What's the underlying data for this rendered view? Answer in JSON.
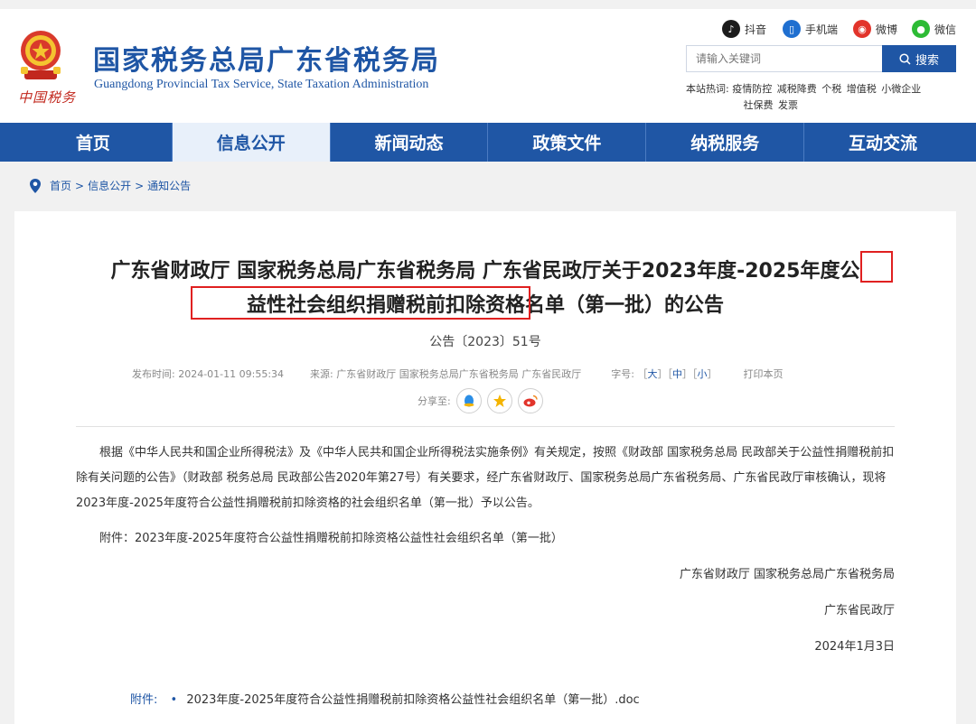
{
  "header": {
    "emblem_script": "中国税务",
    "site_title": "国家税务总局广东省税务局",
    "site_subtitle": "Guangdong Provincial Tax Service, State Taxation Administration",
    "social": {
      "douyin": "抖音",
      "mobile": "手机端",
      "weibo": "微博",
      "wechat": "微信"
    },
    "search": {
      "placeholder": "请输入关键词",
      "button": "搜索"
    },
    "hot": {
      "label": "本站热词:",
      "words": [
        "疫情防控",
        "减税降费",
        "个税",
        "增值税",
        "小微企业",
        "社保费",
        "发票"
      ]
    }
  },
  "nav": {
    "items": [
      "首页",
      "信息公开",
      "新闻动态",
      "政策文件",
      "纳税服务",
      "互动交流"
    ],
    "active_index": 1
  },
  "breadcrumb": [
    "首页",
    "信息公开",
    "通知公告"
  ],
  "article": {
    "title_line1": "广东省财政厅 国家税务总局广东省税务局 广东省民政厅关于2023年度-2025年度公",
    "title_line2": "益性社会组织捐赠税前扣除资格名单（第一批）的公告",
    "doc_no": "公告〔2023〕51号",
    "meta": {
      "published_label": "发布时间:",
      "published": "2024-01-11 09:55:34",
      "source_label": "来源:",
      "source": "广东省财政厅 国家税务总局广东省税务局 广东省民政厅",
      "size_label": "字号:",
      "size_large": "大",
      "size_medium": "中",
      "size_small": "小",
      "print": "打印本页"
    },
    "share_label": "分享至:",
    "body_paragraph": "根据《中华人民共和国企业所得税法》及《中华人民共和国企业所得税法实施条例》有关规定，按照《财政部 国家税务总局 民政部关于公益性捐赠税前扣除有关问题的公告》（财政部 税务总局 民政部公告2020年第27号）有关要求，经广东省财政厅、国家税务总局广东省税务局、广东省民政厅审核确认，现将2023年度-2025年度符合公益性捐赠税前扣除资格的社会组织名单（第一批）予以公告。",
    "attachment_line": "附件：2023年度-2025年度符合公益性捐赠税前扣除资格公益性社会组织名单（第一批）",
    "signers_line": "广东省财政厅 国家税务总局广东省税务局",
    "signer2": "广东省民政厅",
    "date": "2024年1月3日",
    "attachment_label": "附件:",
    "attachment_file": "2023年度-2025年度符合公益性捐赠税前扣除资格公益性社会组织名单（第一批）.doc"
  },
  "colors": {
    "brand_blue": "#1f56a5",
    "highlight_red": "#e02020",
    "emblem_red": "#c2281e"
  }
}
